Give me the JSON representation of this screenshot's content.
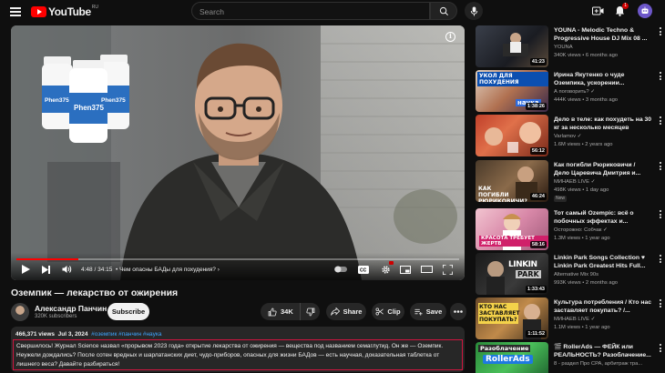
{
  "header": {
    "logo_text": "YouTube",
    "logo_region": "RU",
    "search_placeholder": "Search",
    "notification_count": "1"
  },
  "player": {
    "time_current": "4:48",
    "time_total": "34:15",
    "chapter": "Чем опасны БАДы для похудения?",
    "progress_fraction": 0.14,
    "bottle_label": "Phen375"
  },
  "video": {
    "title": "Оземпик — лекарство от ожирения",
    "channel_name": "Александр Панчин",
    "subscribers": "320K subscribers",
    "subscribe_label": "Subscribe",
    "likes": "34K",
    "share_label": "Share",
    "clip_label": "Clip",
    "save_label": "Save"
  },
  "description": {
    "views": "466,371 views",
    "date": "Jul 3, 2024",
    "tags": "#оземпик #панчин #наука",
    "text": "Свершилось! Журнал Science назвал «прорывом 2023 года» открытие лекарства от ожирения — вещества под названием семаглутид. Он же — Оземпик. Неужели дождались? После сотен вредных и шарлатанских диет, чудо-приборов, опасных для жизни БАДов — есть научная, доказательная таблетка от лишнего веса? Давайте разбираться!"
  },
  "recommendations": [
    {
      "title": "YOUNA - Melodic Techno & Progressive House DJ Mix 08 ...",
      "channel": "YOUNA",
      "meta": "340K views • 6 months ago",
      "duration": "41:23",
      "thumb_text": ""
    },
    {
      "title": "Ирина Якутенко о чуде Оземпика, ускорении...",
      "channel": "А поговорить? ✓",
      "meta": "444K views • 3 months ago",
      "duration": "1:38:26",
      "thumb_text": "УКОЛ ДЛЯ ПОХУДЕНИЯ",
      "thumb_text2": "наука"
    },
    {
      "title": "Дело в теле: как похудеть на 30 кг за несколько месяцев",
      "channel": "Varlamov ✓",
      "meta": "1.6M views • 2 years ago",
      "duration": "56:12",
      "thumb_text": ""
    },
    {
      "title": "Как погибли Рюриковичи / Дело Царевича Дмитрия и...",
      "channel": "МИНАЕВ LIVE ✓",
      "meta": "498K views • 1 day ago",
      "duration": "46:24",
      "badge": "New",
      "thumb_text": "КАК ПОГИБЛИ РЮРИКОВИЧИ?"
    },
    {
      "title": "Тот самый Ozempic: всё о побочных эффектах и...",
      "channel": "Осторожно: Собчак ✓",
      "meta": "1.3M views • 1 year ago",
      "duration": "58:16",
      "thumb_text": "КРАСОТА ТРЕБУЕТ ЖЕРТВ"
    },
    {
      "title": "Linkin Park Songs Collection ♥ Linkin Park Greatest Hits Full...",
      "channel": "Alternative Mix 90s",
      "meta": "993K views • 2 months ago",
      "duration": "1:33:43",
      "thumb_text": "LINKIN",
      "thumb_text2": "PARK"
    },
    {
      "title": "Культура потребления / Кто нас заставляет покупать? /...",
      "channel": "МИНАЕВ LIVE ✓",
      "meta": "1.1M views • 1 year ago",
      "duration": "1:11:52",
      "thumb_text": "КТО НАС ЗАСТАВЛЯЕТ ПОКУПАТЬ?"
    },
    {
      "title": "🎬 RollerAds — ФЕЙК или РЕАЛЬНОСТЬ? Разоблачение...",
      "channel": "8 - раздел Про CPA, арбитраж тра...",
      "meta": "",
      "duration": "",
      "thumb_text": "Разоблачение",
      "thumb_text2": "RollerAds"
    }
  ]
}
